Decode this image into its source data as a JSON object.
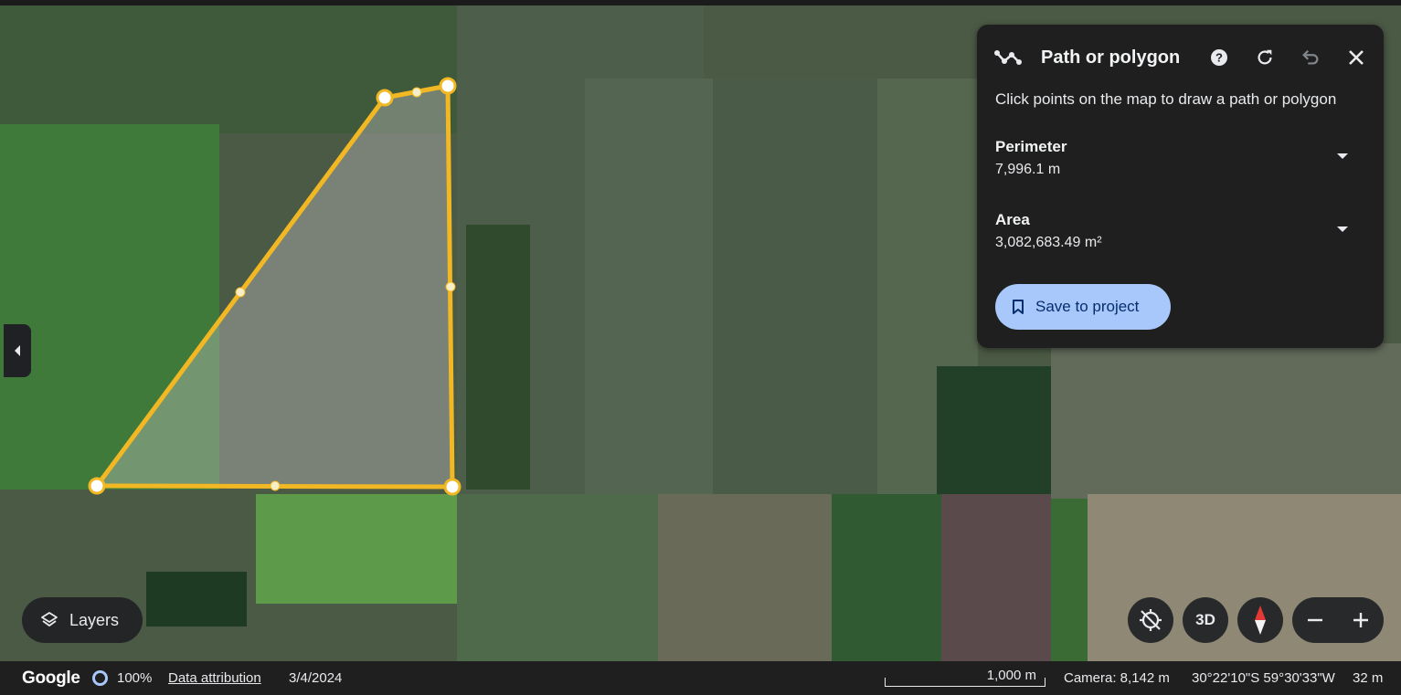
{
  "panel": {
    "title": "Path or polygon",
    "instruction": "Click points on the map to draw a path or polygon",
    "perimeter": {
      "label": "Perimeter",
      "value": "7,996.1 m"
    },
    "area": {
      "label": "Area",
      "value": "3,082,683.49 m²"
    },
    "save_label": "Save to project",
    "icons": [
      "path-icon",
      "help-icon",
      "refresh-icon",
      "undo-icon",
      "close-icon"
    ]
  },
  "map_controls": {
    "layers_label": "Layers",
    "three_d_label": "3D",
    "icons": [
      "layers-icon",
      "location-off-icon",
      "compass-icon",
      "zoom-out-icon",
      "zoom-in-icon",
      "collapse-left-icon"
    ]
  },
  "status_bar": {
    "logo": "Google",
    "loading_percent": "100%",
    "data_attribution": "Data attribution",
    "date": "3/4/2024",
    "scale_label": "1,000 m",
    "camera": "Camera: 8,142 m",
    "coordinates": "30°22'10\"S 59°30'33\"W",
    "elevation": "32 m"
  },
  "colors": {
    "polygon_stroke": "#f2b824",
    "panel_bg": "#1f1f1f",
    "save_button_bg": "#a8c7fa",
    "save_button_text": "#062e6f"
  }
}
